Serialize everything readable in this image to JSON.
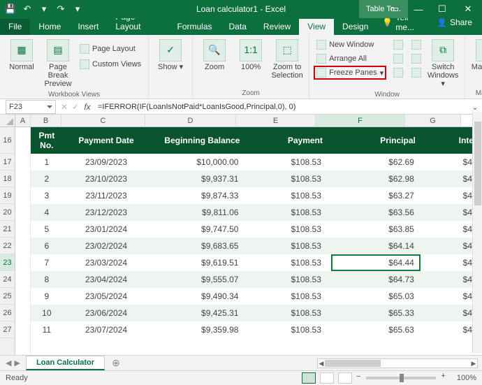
{
  "title": "Loan calculator1 - Excel",
  "table_tools": "Table To...",
  "qat": {
    "save": "💾",
    "undo": "↶",
    "redo": "↷",
    "more": "▾"
  },
  "tabs": [
    "File",
    "Home",
    "Insert",
    "Page Layout",
    "Formulas",
    "Data",
    "Review",
    "View",
    "Design"
  ],
  "active_tab": 7,
  "tellme": "Tell me...",
  "share": "Share",
  "ribbon": {
    "views": {
      "normal": "Normal",
      "pagebreak": "Page Break Preview",
      "pagelayout": "Page Layout",
      "custom": "Custom Views",
      "group": "Workbook Views"
    },
    "show": {
      "label": "Show",
      "group": ""
    },
    "zoom": {
      "zoom": "Zoom",
      "p100": "100%",
      "zsel": "Zoom to Selection",
      "group": "Zoom"
    },
    "window": {
      "neww": "New Window",
      "arrange": "Arrange All",
      "freeze": "Freeze Panes",
      "switch": "Switch Windows",
      "group": "Window"
    },
    "macros": {
      "label": "Macros",
      "group": "Macros"
    }
  },
  "namebox": "F23",
  "formula": "=IFERROR(IF(LoanIsNotPaid*LoanIsGood,Principal,0), 0)",
  "col_letters": [
    "A",
    "B",
    "C",
    "D",
    "E",
    "F",
    "G"
  ],
  "row_numbers": [
    "16",
    "17",
    "18",
    "19",
    "20",
    "21",
    "22",
    "23",
    "24",
    "25",
    "26",
    "27"
  ],
  "active_row_idx": 7,
  "active_col_idx": 5,
  "headers": {
    "pmt": "Pmt No.",
    "date": "Payment Date",
    "begbal": "Beginning Balance",
    "payment": "Payment",
    "principal": "Principal",
    "interest": "Inte"
  },
  "rows": [
    {
      "pmt": "1",
      "date": "23/09/2023",
      "begbal": "$10,000.00",
      "payment": "$108.53",
      "principal": "$62.69",
      "interest": "$4"
    },
    {
      "pmt": "2",
      "date": "23/10/2023",
      "begbal": "$9,937.31",
      "payment": "$108.53",
      "principal": "$62.98",
      "interest": "$4"
    },
    {
      "pmt": "3",
      "date": "23/11/2023",
      "begbal": "$9,874.33",
      "payment": "$108.53",
      "principal": "$63.27",
      "interest": "$4"
    },
    {
      "pmt": "4",
      "date": "23/12/2023",
      "begbal": "$9,811.06",
      "payment": "$108.53",
      "principal": "$63.56",
      "interest": "$4"
    },
    {
      "pmt": "5",
      "date": "23/01/2024",
      "begbal": "$9,747.50",
      "payment": "$108.53",
      "principal": "$63.85",
      "interest": "$4"
    },
    {
      "pmt": "6",
      "date": "23/02/2024",
      "begbal": "$9,683.65",
      "payment": "$108.53",
      "principal": "$64.14",
      "interest": "$4"
    },
    {
      "pmt": "7",
      "date": "23/03/2024",
      "begbal": "$9,619.51",
      "payment": "$108.53",
      "principal": "$64.44",
      "interest": "$4"
    },
    {
      "pmt": "8",
      "date": "23/04/2024",
      "begbal": "$9,555.07",
      "payment": "$108.53",
      "principal": "$64.73",
      "interest": "$4"
    },
    {
      "pmt": "9",
      "date": "23/05/2024",
      "begbal": "$9,490.34",
      "payment": "$108.53",
      "principal": "$65.03",
      "interest": "$4"
    },
    {
      "pmt": "10",
      "date": "23/06/2024",
      "begbal": "$9,425.31",
      "payment": "$108.53",
      "principal": "$65.33",
      "interest": "$4"
    },
    {
      "pmt": "11",
      "date": "23/07/2024",
      "begbal": "$9,359.98",
      "payment": "$108.53",
      "principal": "$65.63",
      "interest": "$4"
    }
  ],
  "sheet_tab": "Loan Calculator",
  "status_ready": "Ready",
  "zoom": "100%"
}
